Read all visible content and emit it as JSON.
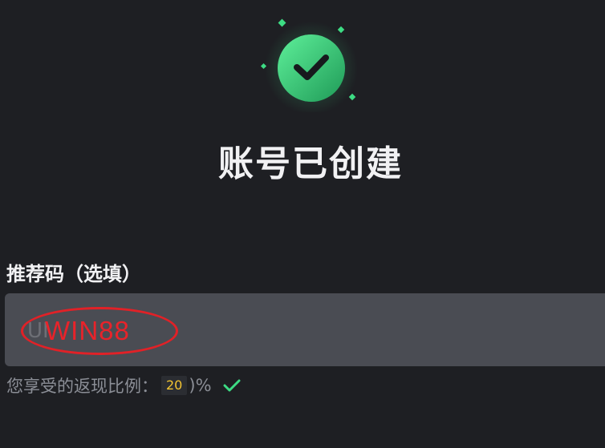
{
  "header": {
    "title": "账号已创建",
    "success_icon": "check-circle-icon",
    "accent_color": "#3ddc84"
  },
  "referral": {
    "label": "推荐码（选填）",
    "placeholder": "UI",
    "entered_code_annotation": "WIN88"
  },
  "rebate": {
    "label": "您享受的返现比例：",
    "value": "20",
    "paren": ")",
    "unit": "%",
    "status_icon": "check-icon",
    "value_color": "#f4c531"
  }
}
